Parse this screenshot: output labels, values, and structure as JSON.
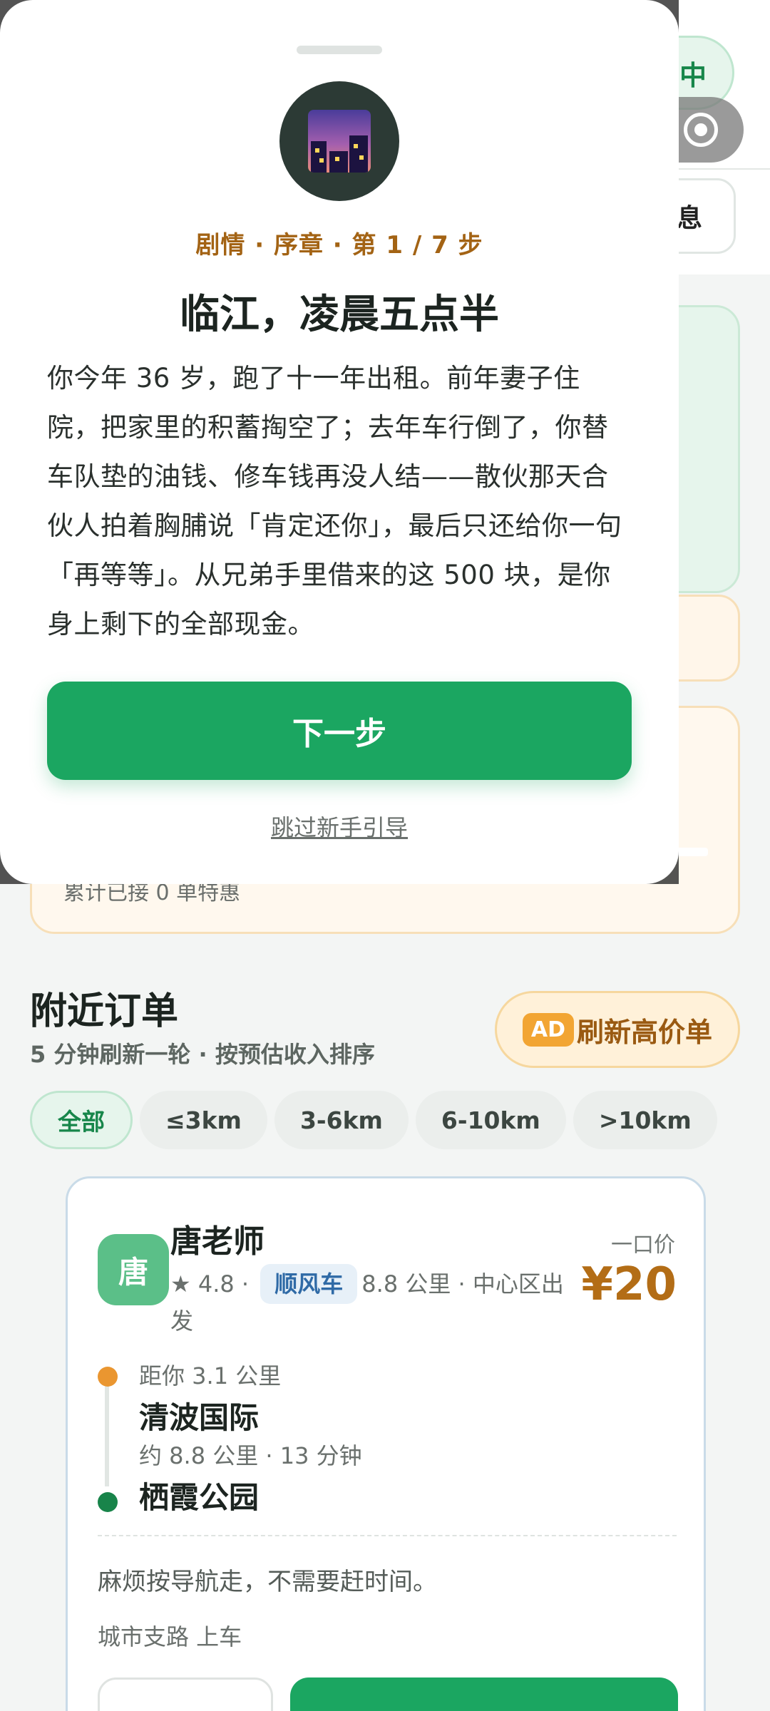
{
  "topbar": {
    "online_label": "中",
    "message_label": "息"
  },
  "stats_card": {
    "accepted_text": "累计已接 0 单特惠"
  },
  "nearby": {
    "title": "附近订单",
    "subtitle": "5 分钟刷新一轮 · 按预估收入排序",
    "ad_badge": "AD",
    "refresh_label": "刷新高价单",
    "filters": [
      "全部",
      "≤3km",
      "3-6km",
      "6-10km",
      ">10km"
    ],
    "active_filter": "全部"
  },
  "order": {
    "avatar_char": "唐",
    "passenger": "唐老师",
    "rating": "★ 4.8",
    "tag": "顺风车",
    "meta_tail": "8.8 公里 · 中心区出发",
    "price_label": "一口价",
    "price": "¥20",
    "distance_to_you": "距你 3.1 公里",
    "from": "清波国际",
    "trip": "约 8.8 公里 · 13 分钟",
    "to": "栖霞公园",
    "note": "麻烦按导航走，不需要赶时间。",
    "pickup": "城市支路 上车"
  },
  "modal": {
    "icon": "night-city-icon",
    "chapter": "剧情 · 序章 · 第 1 / 7 步",
    "title": "临江，凌晨五点半",
    "body": "你今年 36 岁，跑了十一年出租。前年妻子住院，把家里的积蓄掏空了；去年车行倒了，你替车队垫的油钱、修车钱再没人结——散伙那天合伙人拍着胸脯说「肯定还你」，最后只还给你一句「再等等」。从兄弟手里借来的这 500 块，是你身上剩下的全部现金。",
    "next_label": "下一步",
    "skip_label": "跳过新手引导"
  },
  "colors": {
    "primary": "#1ba661",
    "accent": "#a36314",
    "price": "#b36d16"
  }
}
